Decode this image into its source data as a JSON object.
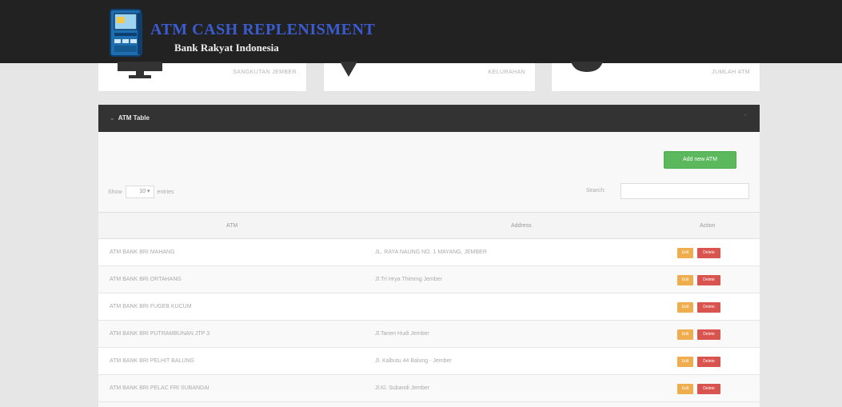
{
  "header": {
    "title": "ATM CASH REPLENISMENT",
    "subtitle": "Bank Rakyat Indonesia",
    "logo_icon": "atm-machine-icon"
  },
  "stats": [
    {
      "label": "SANGKUTAN JEMBER",
      "icon": "monitor-icon"
    },
    {
      "label": "KELURAHAN",
      "icon": "map-marker-icon"
    },
    {
      "label": "JUMLAH ATM",
      "icon": "chat-bubble-icon"
    }
  ],
  "panel": {
    "title": "ATM Table",
    "add_button": "Add new ATM"
  },
  "controls": {
    "show_label": "Show",
    "page_length": "10",
    "entries_label": "entries",
    "search_label": "Search:",
    "search_value": ""
  },
  "table": {
    "headers": [
      "ATM",
      "Address",
      "Action"
    ],
    "edit_label": "Edit",
    "delete_label": "Delete",
    "rows": [
      {
        "atm": "ATM BANK BRI MAHANG",
        "address": "JL. RAYA NAUNG NO. 1 MAYANG, JEMBER"
      },
      {
        "atm": "ATM BANK BRI ORTAHANG",
        "address": "Jl.Tri Hrya Thimmg Jember"
      },
      {
        "atm": "ATM BANK BRI FUGEB KUCUM",
        "address": ""
      },
      {
        "atm": "ATM BANK BRI PUTRAMBUNAN JTP 3",
        "address": "Jl.Tanen Hudi Jember"
      },
      {
        "atm": "ATM BANK BRI PELHIT BALUNG",
        "address": "Jl. Kalbutu 44 Balung - Jember"
      },
      {
        "atm": "ATM BANK BRI PELAC FRI SUBANDAI",
        "address": "Jl.Kl. Subandi Jember"
      }
    ]
  },
  "colors": {
    "header_bg": "#222222",
    "title_blue": "#3b5bd0",
    "add_green": "#5cb85c",
    "edit_orange": "#f0ad4e",
    "delete_red": "#d9534f"
  }
}
